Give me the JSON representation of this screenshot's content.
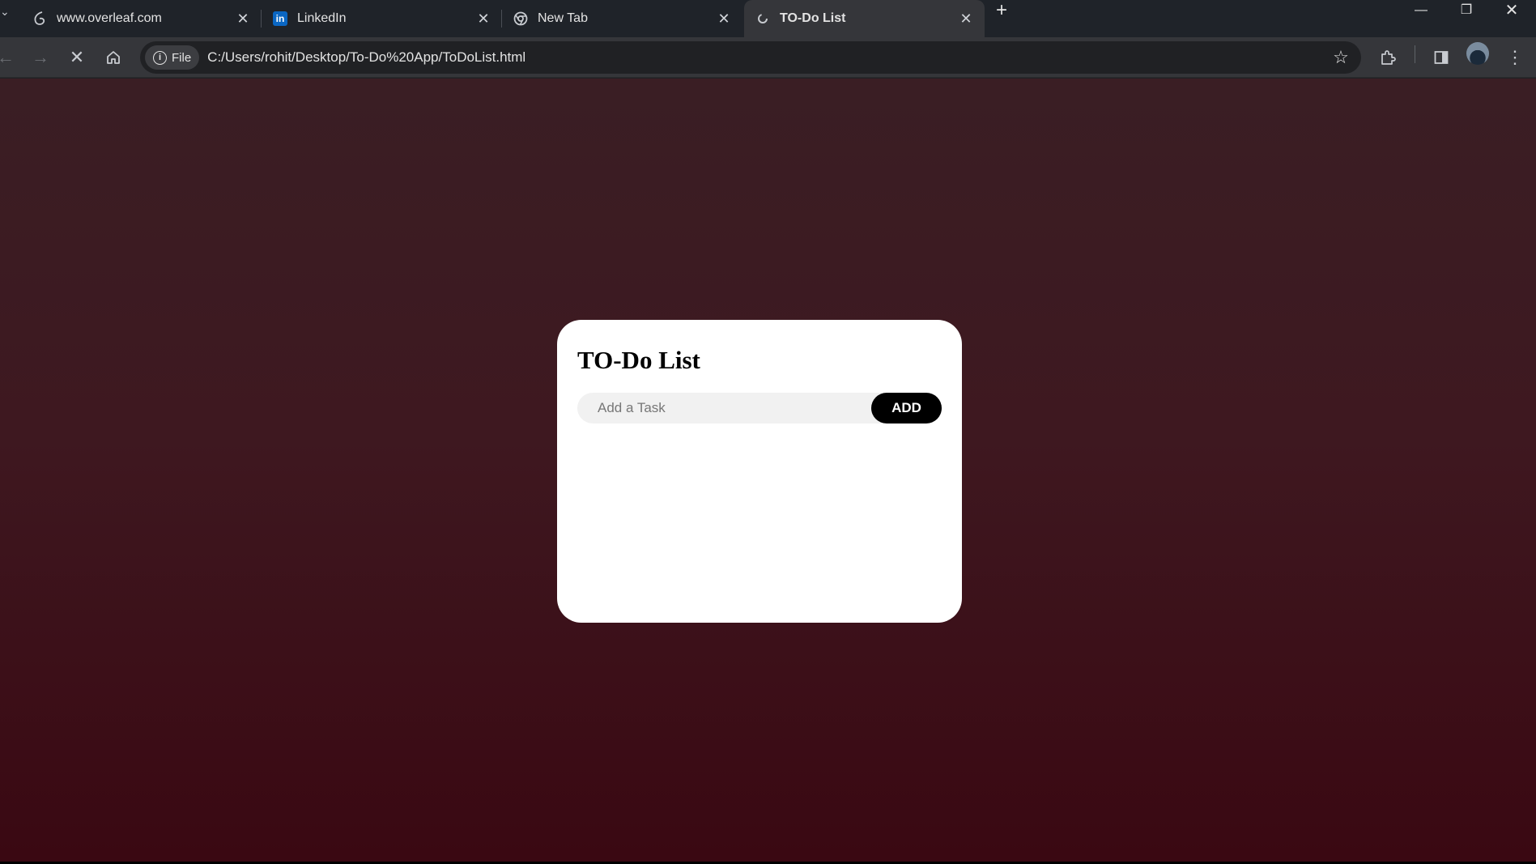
{
  "browser": {
    "tabs": [
      {
        "label": "www.overleaf.com",
        "icon": "overleaf-icon",
        "active": false
      },
      {
        "label": "LinkedIn",
        "icon": "linkedin-icon",
        "active": false
      },
      {
        "label": "New Tab",
        "icon": "chrome-icon",
        "active": false
      },
      {
        "label": "TO-Do List",
        "icon": "loading-icon",
        "active": true
      }
    ],
    "linkedin_logo_text": "in",
    "omnibox": {
      "chip_label": "File",
      "url": "C:/Users/rohit/Desktop/To-Do%20App/ToDoList.html"
    }
  },
  "app": {
    "title": "TO-Do List",
    "input_placeholder": "Add a Task",
    "input_value": "",
    "add_button_label": "ADD",
    "tasks": []
  },
  "colors": {
    "background_top": "#3a1e24",
    "background_bottom": "#3a0812",
    "card": "#ffffff",
    "button": "#000000"
  }
}
